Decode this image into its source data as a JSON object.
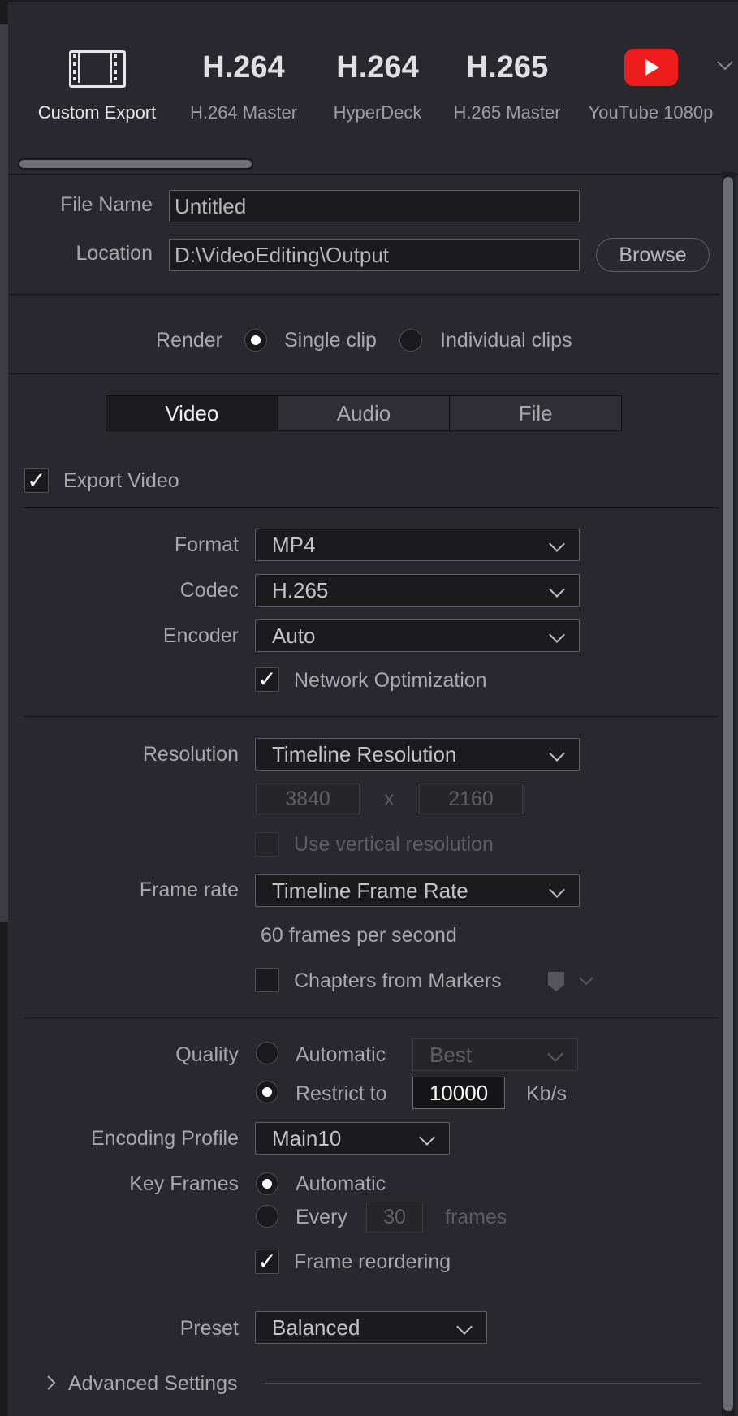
{
  "presets": [
    {
      "big": "",
      "label": "Custom Export",
      "icon": "film-strip-icon"
    },
    {
      "big": "H.264",
      "label": "H.264 Master"
    },
    {
      "big": "H.264",
      "label": "HyperDeck"
    },
    {
      "big": "H.265",
      "label": "H.265 Master"
    },
    {
      "big": "",
      "label": "YouTube 1080p",
      "icon": "youtube-icon"
    }
  ],
  "file": {
    "name_label": "File Name",
    "name_value": "Untitled",
    "location_label": "Location",
    "location_value": "D:\\VideoEditing\\Output",
    "browse_label": "Browse"
  },
  "render": {
    "label": "Render",
    "single_clip": "Single clip",
    "individual_clips": "Individual clips"
  },
  "tabs": [
    "Video",
    "Audio",
    "File"
  ],
  "video": {
    "export_label": "Export Video",
    "format_label": "Format",
    "format_value": "MP4",
    "codec_label": "Codec",
    "codec_value": "H.265",
    "encoder_label": "Encoder",
    "encoder_value": "Auto",
    "network_opt": "Network Optimization",
    "resolution_label": "Resolution",
    "resolution_value": "Timeline Resolution",
    "width": "3840",
    "x_sep": "x",
    "height": "2160",
    "vertical_res": "Use vertical resolution",
    "framerate_label": "Frame rate",
    "framerate_value": "Timeline Frame Rate",
    "fps_text": "60 frames per second",
    "chapters": "Chapters from Markers",
    "quality_label": "Quality",
    "quality_auto": "Automatic",
    "quality_best": "Best",
    "restrict_label": "Restrict to",
    "restrict_value": "10000",
    "restrict_unit": "Kb/s",
    "enc_profile_label": "Encoding Profile",
    "enc_profile_value": "Main10",
    "keyframes_label": "Key Frames",
    "keyframes_auto": "Automatic",
    "keyframes_every": "Every",
    "keyframes_every_value": "30",
    "keyframes_unit": "frames",
    "frame_reorder": "Frame reordering",
    "preset_label": "Preset",
    "preset_value": "Balanced",
    "advanced": "Advanced Settings"
  }
}
